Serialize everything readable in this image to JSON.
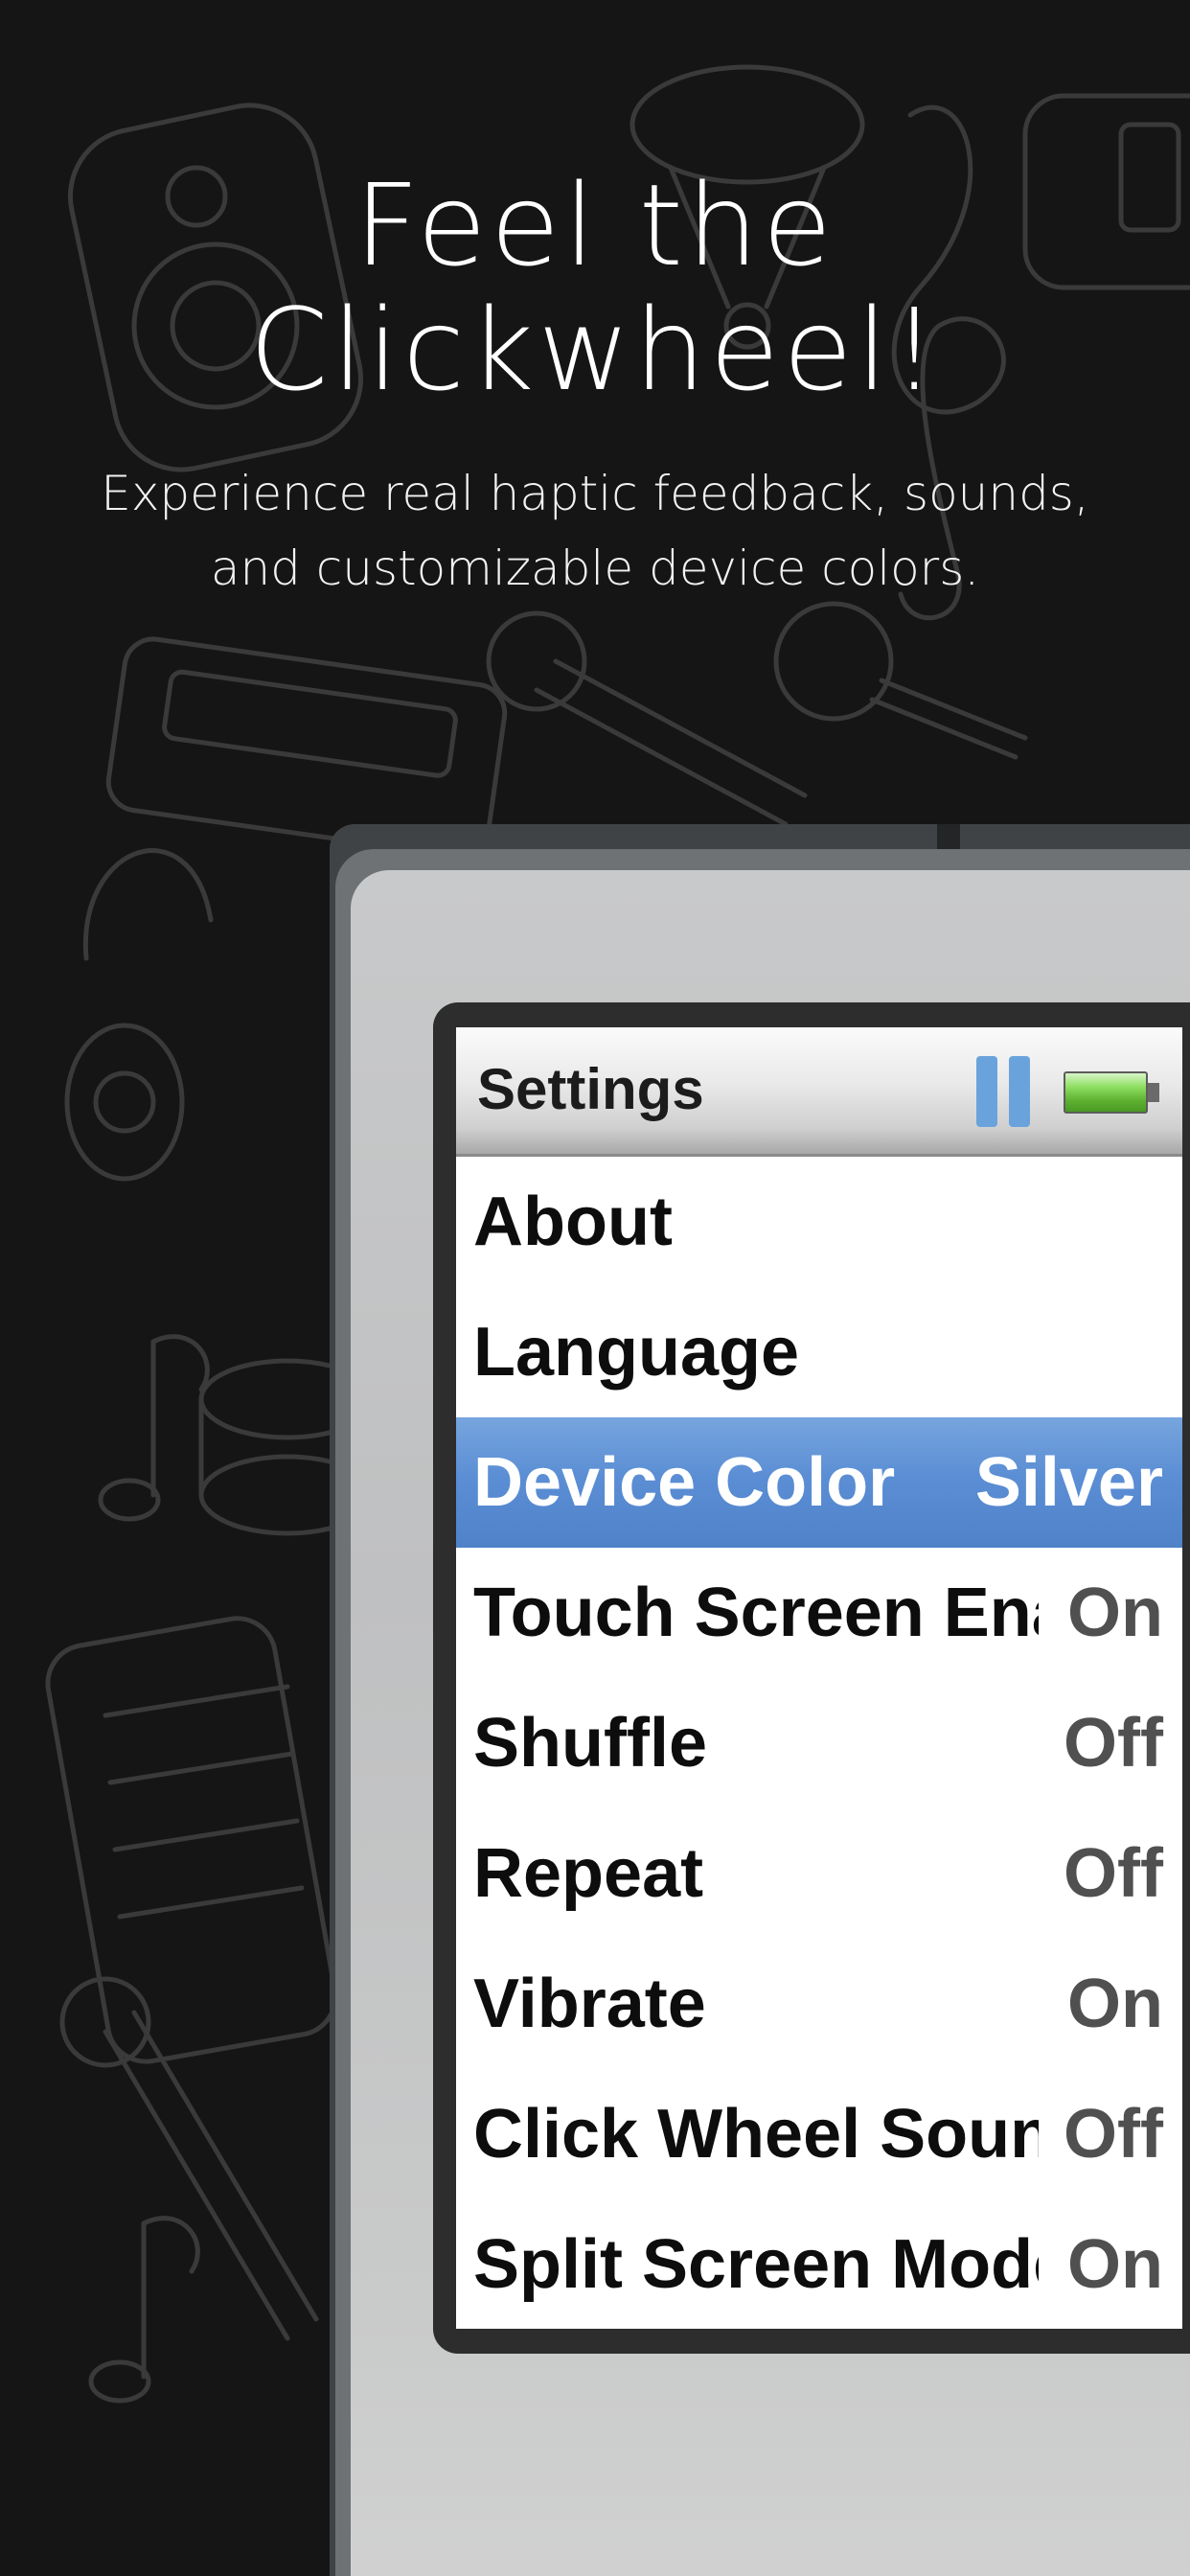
{
  "headline": {
    "line1": "Feel the",
    "line2": "Clickwheel!"
  },
  "subhead": {
    "line1": "Experience real haptic feedback, sounds,",
    "line2": "and customizable device colors."
  },
  "screen": {
    "title": "Settings",
    "status_icons": [
      "pause-icon",
      "battery-icon"
    ],
    "selection_color": "#5b8ed4",
    "rows": [
      {
        "label": "About",
        "value": "",
        "selected": false
      },
      {
        "label": "Language",
        "value": "",
        "selected": false
      },
      {
        "label": "Device Color",
        "value": "Silver",
        "selected": true
      },
      {
        "label": "Touch Screen Enabled",
        "value": "On",
        "selected": false
      },
      {
        "label": "Shuffle",
        "value": "Off",
        "selected": false
      },
      {
        "label": "Repeat",
        "value": "Off",
        "selected": false
      },
      {
        "label": "Vibrate",
        "value": "On",
        "selected": false
      },
      {
        "label": "Click Wheel Sound",
        "value": "Off",
        "selected": false
      },
      {
        "label": "Split Screen Mode",
        "value": "On",
        "selected": false
      }
    ]
  }
}
